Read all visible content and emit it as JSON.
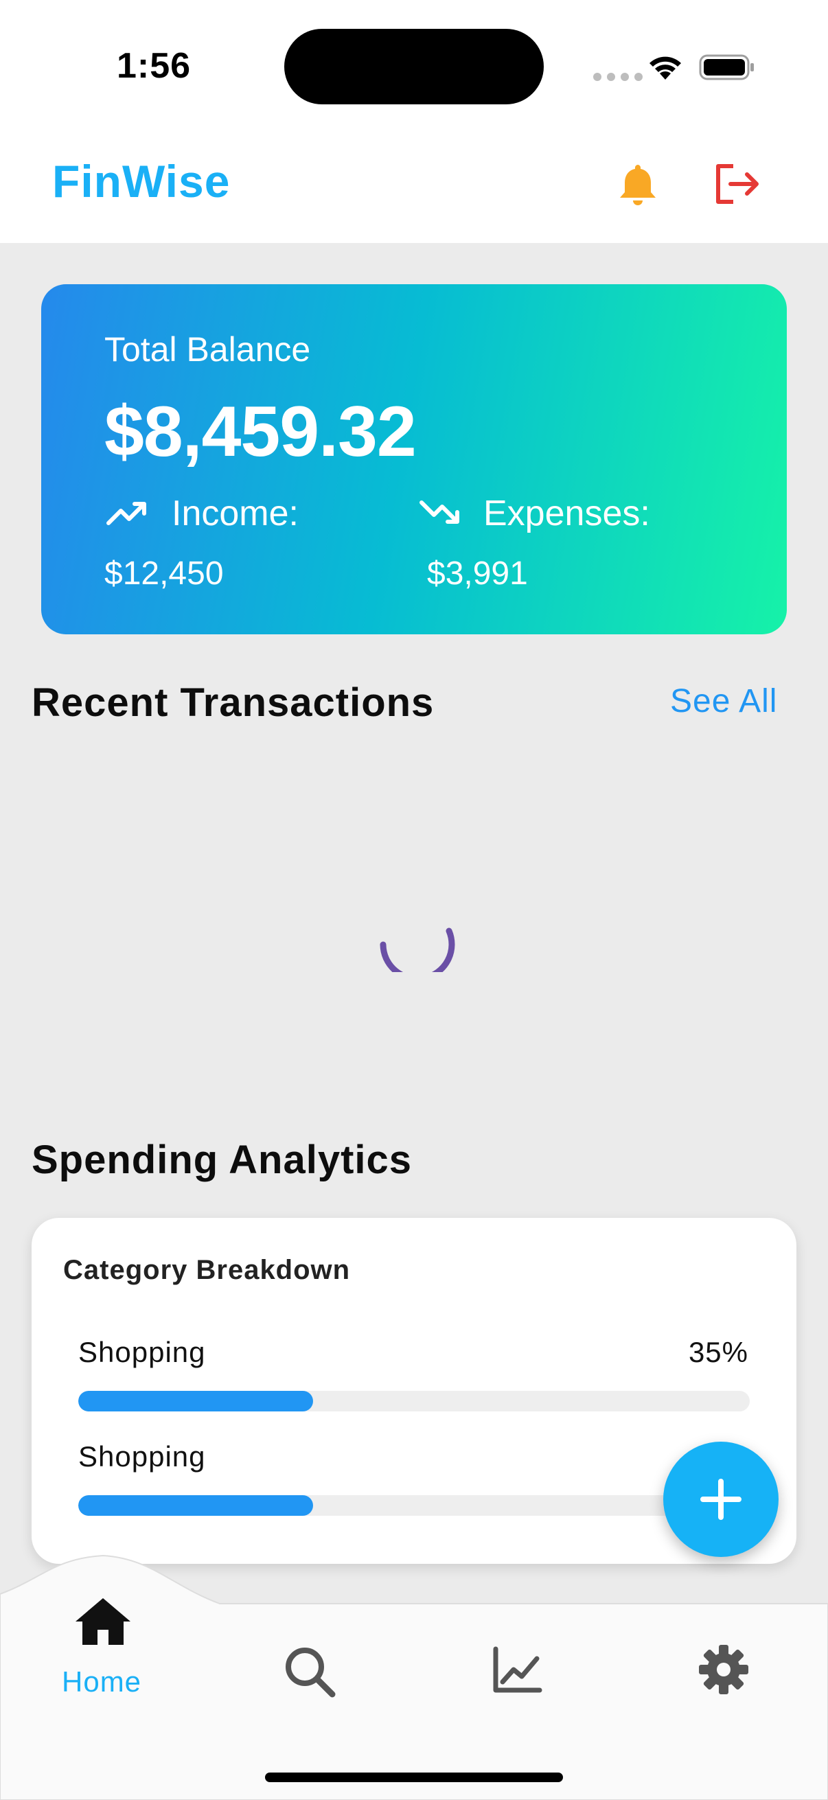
{
  "status_bar": {
    "time": "1:56"
  },
  "header": {
    "app_title": "FinWise"
  },
  "balance": {
    "label": "Total Balance",
    "value": "$8,459.32",
    "income_label": "Income:",
    "income_value": "$12,450",
    "expenses_label": "Expenses:",
    "expenses_value": "$3,991"
  },
  "recent_transactions": {
    "title": "Recent Transactions",
    "see_all": "See All"
  },
  "analytics": {
    "title": "Spending Analytics",
    "card_title": "Category Breakdown",
    "rows": [
      {
        "label": "Shopping",
        "percent_text": "35%",
        "fraction": 0.35
      },
      {
        "label": "Shopping",
        "percent_text": "",
        "fraction": 0.35
      }
    ]
  },
  "bottom_nav": {
    "home_label": "Home"
  },
  "colors": {
    "brand": "#1ab0f6",
    "bell": "#f9a825",
    "logout": "#e53935",
    "progress": "#2196f3",
    "spinner": "#6a4fa6"
  },
  "icons": [
    "wifi-icon",
    "battery-icon",
    "bell-icon",
    "logout-icon",
    "trending-up-icon",
    "trending-down-icon",
    "plus-icon",
    "home-icon",
    "search-icon",
    "chart-icon",
    "gear-icon"
  ]
}
